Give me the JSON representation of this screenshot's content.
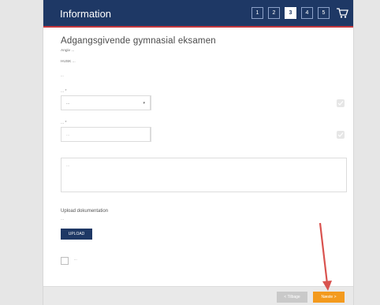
{
  "header": {
    "title": "Information",
    "steps": [
      {
        "label": "1",
        "active": false
      },
      {
        "label": "2",
        "active": false
      },
      {
        "label": "3",
        "active": true
      },
      {
        "label": "4",
        "active": false
      },
      {
        "label": "5",
        "active": false
      }
    ]
  },
  "form": {
    "title": "Adgangsgivende gymnasial eksamen",
    "subtitle": "Angiv ...",
    "note": "HUSK ...",
    "description": "...",
    "select_label": "... *",
    "select_value": "...",
    "text_label": "... *",
    "text_placeholder": "...",
    "textarea_placeholder": "...",
    "upload_heading": "Upload dokumentation",
    "upload_subtext": "...",
    "upload_button": "UPLOAD",
    "consent_text": "..."
  },
  "footer": {
    "back_label": "< Tilbage",
    "next_label": "Næste >"
  },
  "colors": {
    "header_bg": "#1e3865",
    "accent_red": "#c5373d",
    "next_orange": "#f39a1e",
    "arrow_red": "#d9534f"
  }
}
